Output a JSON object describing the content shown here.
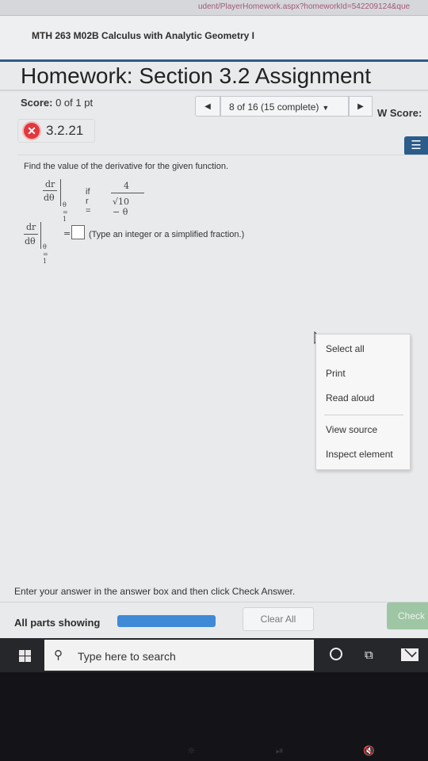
{
  "browser": {
    "url_fragment": "udent/PlayerHomework.aspx?homeworkId=542209124&que"
  },
  "course": {
    "title": "MTH 263 M02B Calculus with Analytic Geometry I"
  },
  "homework": {
    "title": "Homework: Section 3.2 Assignment",
    "score_label": "Score:",
    "score_value": "0 of 1 pt",
    "prev_icon": "◀",
    "progress_text": "8 of 16 (15 complete)",
    "dropdown_caret": "▼",
    "next_icon": "▶",
    "w_score_label": "W Score:"
  },
  "question": {
    "status_icon": "✕",
    "id": "3.2.21",
    "menu_icon": "☰",
    "prompt": "Find the value of the derivative for the given function.",
    "deriv_num": "dr",
    "deriv_den": "dθ",
    "eval_at": "θ = 1",
    "if_text": "if r =",
    "r_numerator": "4",
    "r_denominator": "√10 − θ",
    "equals": "=",
    "answer_value": "",
    "answer_hint": "(Type an integer or a simplified fraction.)"
  },
  "context_menu": {
    "items": [
      "Select all",
      "Print",
      "Read aloud",
      "View source",
      "Inspect element"
    ]
  },
  "footer": {
    "instruction": "Enter your answer in the answer box and then click Check Answer.",
    "parts_label": "All parts showing",
    "progress_fraction": 1.0,
    "clear_label": "Clear All",
    "check_label": "Check"
  },
  "taskbar": {
    "search_icon": "⚲",
    "search_placeholder": "Type here to search",
    "taskview_icon": "⧉"
  },
  "bezel": {
    "keys": [
      "☼",
      "⏯",
      "🔇"
    ]
  },
  "colors": {
    "accent": "#2b5c8a",
    "error": "#e2373c",
    "progress": "#3f8ad6",
    "check_button": "#9fc6a4"
  }
}
